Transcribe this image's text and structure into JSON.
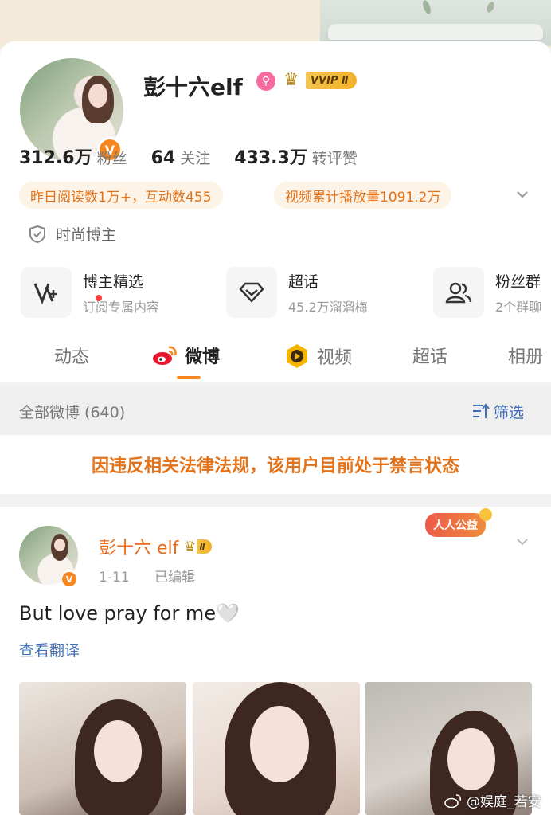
{
  "profile": {
    "name": "彭十六elf",
    "vip_label": "VVIP Ⅱ",
    "stats": [
      {
        "value": "312.6万",
        "label": "粉丝"
      },
      {
        "value": "64",
        "label": "关注"
      },
      {
        "value": "433.3万",
        "label": "转评赞"
      }
    ],
    "pill_reads": "昨日阅读数1万+，互动数455",
    "pill_video": "视频累计播放量1091.2万",
    "category": "时尚博主"
  },
  "quick_links": [
    {
      "title": "博主精选",
      "subtitle": "订阅专属内容"
    },
    {
      "title": "超话",
      "subtitle": "45.2万溜溜梅"
    },
    {
      "title": "粉丝群",
      "subtitle": "2个群聊"
    }
  ],
  "tabs": [
    "动态",
    "微博",
    "视频",
    "超话",
    "相册"
  ],
  "filter": {
    "all_label": "全部微博 (640)",
    "filter_label": "筛选"
  },
  "ban_notice": "因违反相关法律法规，该用户目前处于禁言状态",
  "post": {
    "author": "彭十六 elf",
    "vip_label": "Ⅱ",
    "date": "1-11",
    "edited": "已编辑",
    "charity_badge": "人人公益",
    "text": "But love pray for me🤍",
    "translate": "查看翻译"
  },
  "watermark": "@娱庭_若安",
  "colors": {
    "accent": "#f7861e",
    "link": "#3f6fb5",
    "ban_text": "#e2731a",
    "pill_bg": "#fdf3e6"
  }
}
